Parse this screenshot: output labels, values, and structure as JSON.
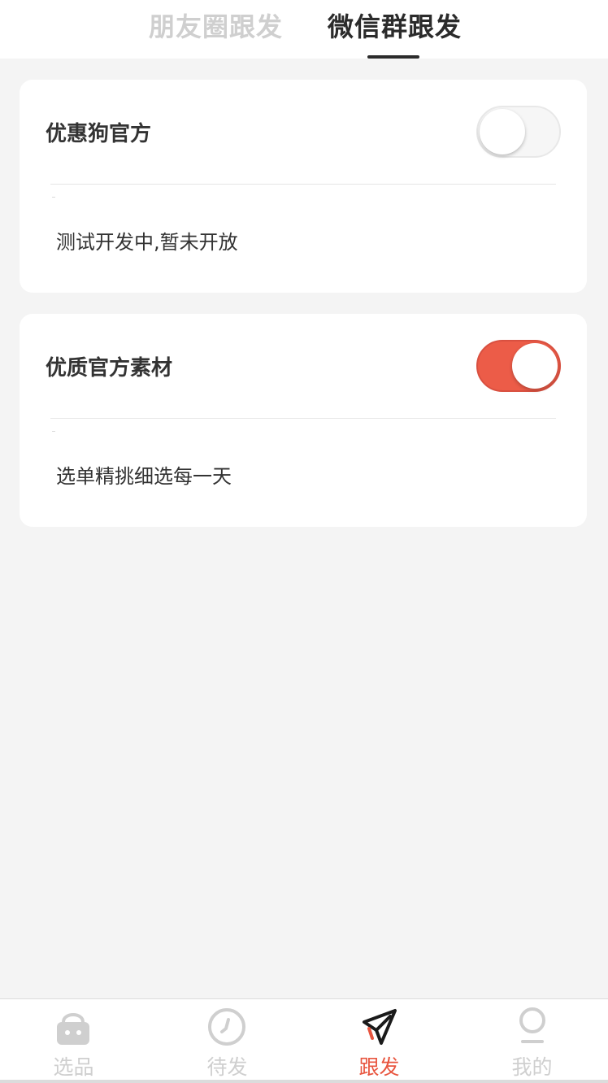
{
  "top_tabs": {
    "moments_follow": "朋友圈跟发",
    "wechat_group_follow": "微信群跟发"
  },
  "cards": [
    {
      "title": "优惠狗官方",
      "description": "测试开发中,暂未开放",
      "toggle": "off"
    },
    {
      "title": "优质官方素材",
      "description": "选单精挑细选每一天",
      "toggle": "on"
    }
  ],
  "bottom_nav": {
    "items": [
      {
        "label": "选品",
        "icon": "shopping-basket-icon"
      },
      {
        "label": "待发",
        "icon": "clock-icon"
      },
      {
        "label": "跟发",
        "icon": "paper-plane-icon",
        "active": true
      },
      {
        "label": "我的",
        "icon": "user-icon"
      }
    ]
  },
  "colors": {
    "accent": "#ec5c48",
    "active_text": "#e8553f",
    "inactive": "#cfcfcf",
    "background": "#f4f4f4"
  }
}
